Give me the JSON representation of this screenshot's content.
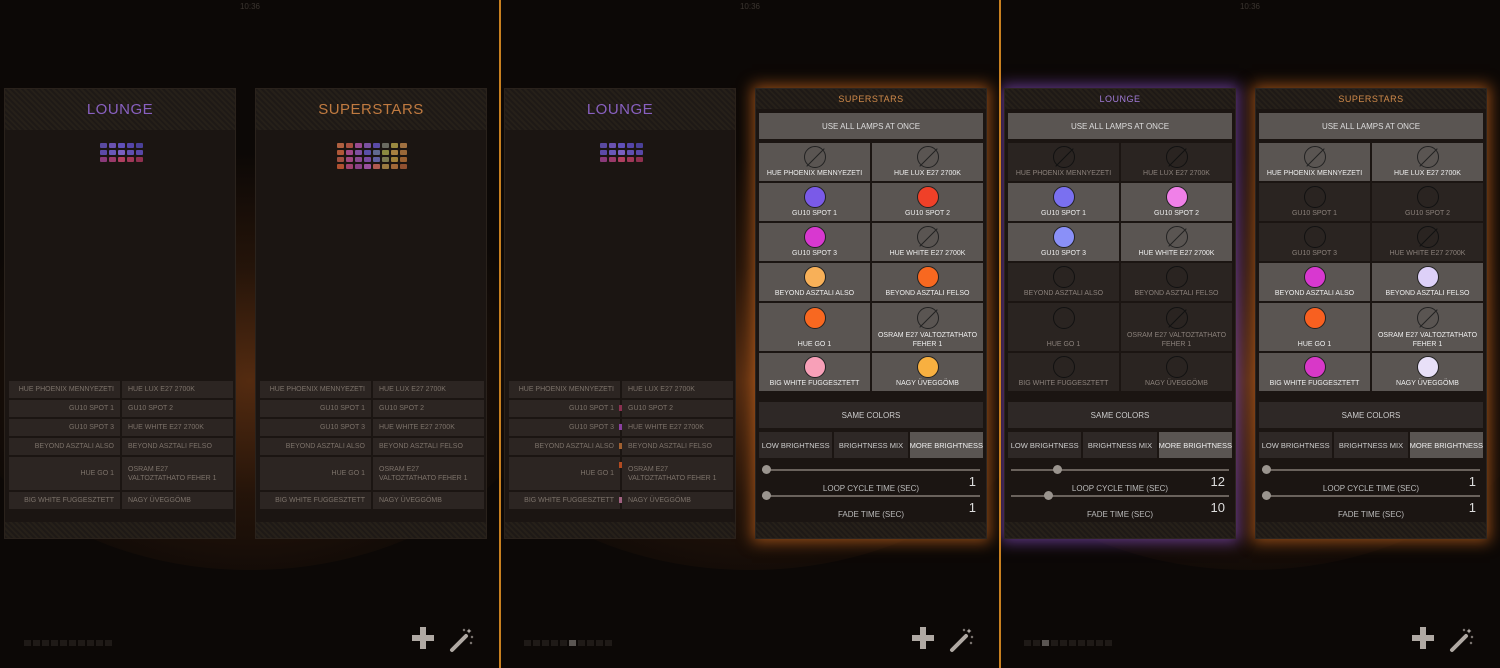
{
  "screens": [
    {
      "time": "10:36",
      "active_page": -1,
      "glow_color": "#c06020",
      "panels": [
        {
          "type": "collapsed",
          "title": "LOUNGE",
          "title_color": "#8860c0",
          "mini_grid": [
            "#5a4aa0",
            "#6a52b0",
            "#6050b8",
            "#5545a8",
            "#4a4098",
            "#5c4aa8",
            "#6a58b8",
            "#7a60c0",
            "#6050b0",
            "#5848a8",
            "#8a3a7a",
            "#9a3a6a",
            "#b04060",
            "#a03858",
            "#903050"
          ],
          "rows": [
            [
              {
                "label": "HUE PHOENIX MENNYEZETI"
              },
              {
                "label": "HUE LUX E27 2700K"
              }
            ],
            [
              {
                "label": "GU10 SPOT 1"
              },
              {
                "label": "GU10 SPOT 2"
              }
            ],
            [
              {
                "label": "GU10 SPOT 3"
              },
              {
                "label": "HUE WHITE E27 2700K"
              }
            ],
            [
              {
                "label": "BEYOND ASZTALI ALSO"
              },
              {
                "label": "BEYOND ASZTALI FELSO"
              }
            ],
            [
              {
                "label": "HUE GO 1",
                "tall": true
              },
              {
                "label": "OSRAM E27 VALTOZTATHATO FEHER 1",
                "tall": true
              }
            ],
            [
              {
                "label": "BIG WHITE FUGGESZTETT"
              },
              {
                "label": "NAGY ÜVEGGÖMB"
              }
            ]
          ]
        },
        {
          "type": "collapsed",
          "title": "SUPERSTARS",
          "title_color": "#c07a40",
          "mini_grid": [
            "#b06040",
            "#a85040",
            "#9a4a90",
            "#7a50a0",
            "#5a4aa8",
            "#6a6a60",
            "#9a8a40",
            "#a07040",
            "#b05838",
            "#a04888",
            "#8050a0",
            "#5a50a8",
            "#606a90",
            "#8a8a40",
            "#a88040",
            "#9a6838",
            "#a05040",
            "#a04880",
            "#8a4a90",
            "#7a4aa0",
            "#6060a0",
            "#7a7a50",
            "#a08038",
            "#9a6030",
            "#b05030",
            "#a04070",
            "#8a4088",
            "#9a50a0",
            "#b05a50",
            "#9a7a40",
            "#a06838",
            "#905030"
          ],
          "rows": [
            [
              {
                "label": "HUE PHOENIX MENNYEZETI"
              },
              {
                "label": "HUE LUX E27 2700K"
              }
            ],
            [
              {
                "label": "GU10 SPOT 1"
              },
              {
                "label": "GU10 SPOT 2"
              }
            ],
            [
              {
                "label": "GU10 SPOT 3"
              },
              {
                "label": "HUE WHITE E27 2700K"
              }
            ],
            [
              {
                "label": "BEYOND ASZTALI ALSO"
              },
              {
                "label": "BEYOND ASZTALI FELSO"
              }
            ],
            [
              {
                "label": "HUE GO 1",
                "tall": true
              },
              {
                "label": "OSRAM E27 VALTOZTATHATO FEHER 1",
                "tall": true
              }
            ],
            [
              {
                "label": "BIG WHITE FUGGESZTETT"
              },
              {
                "label": "NAGY ÜVEGGÖMB"
              }
            ]
          ]
        }
      ]
    },
    {
      "time": "10:36",
      "active_page": 5,
      "glow_color": "#c06020",
      "panels": [
        {
          "type": "collapsed",
          "title": "LOUNGE",
          "title_color": "#8860c0",
          "mini_grid": [
            "#5a4aa0",
            "#6a52b0",
            "#6050b8",
            "#5545a8",
            "#4a4098",
            "#5c4aa8",
            "#6a58b8",
            "#7a60c0",
            "#6050b0",
            "#5848a8",
            "#8a3a7a",
            "#9a3a6a",
            "#b04060",
            "#a03858",
            "#903050"
          ],
          "rows": [
            [
              {
                "label": "HUE PHOENIX MENNYEZETI"
              },
              {
                "label": "HUE LUX E27 2700K"
              }
            ],
            [
              {
                "label": "GU10 SPOT 1",
                "swatch": "#8a3050"
              },
              {
                "label": "GU10 SPOT 2"
              }
            ],
            [
              {
                "label": "GU10 SPOT 3",
                "swatch": "#8a40a0"
              },
              {
                "label": "HUE WHITE E27 2700K"
              }
            ],
            [
              {
                "label": "BEYOND ASZTALI ALSO",
                "swatch": "#a06030"
              },
              {
                "label": "BEYOND ASZTALI FELSO"
              }
            ],
            [
              {
                "label": "HUE GO 1",
                "tall": true,
                "swatch": "#b04a20"
              },
              {
                "label": "OSRAM E27 VALTOZTATHATO FEHER 1",
                "tall": true
              }
            ],
            [
              {
                "label": "BIG WHITE FUGGESZTETT",
                "swatch": "#a06080"
              },
              {
                "label": "NAGY ÜVEGGÖMB"
              }
            ]
          ]
        },
        {
          "type": "expanded",
          "title": "SUPERSTARS",
          "title_color": "#d08a4a",
          "border_glow": "#d06a20",
          "use_all_label": "USE ALL LAMPS AT ONCE",
          "lamps": [
            {
              "name": "HUE PHOENIX MENNYEZETI",
              "color": null,
              "dim": false
            },
            {
              "name": "HUE LUX E27 2700K",
              "color": null,
              "dim": false
            },
            {
              "name": "GU10 SPOT 1",
              "color": "#7a5ae8",
              "dim": false
            },
            {
              "name": "GU10 SPOT 2",
              "color": "#f04028",
              "dim": false
            },
            {
              "name": "GU10 SPOT 3",
              "color": "#d838d0",
              "dim": false
            },
            {
              "name": "HUE WHITE E27 2700K",
              "color": null,
              "dim": false
            },
            {
              "name": "BEYOND ASZTALI ALSO",
              "color": "#f8b058",
              "dim": false
            },
            {
              "name": "BEYOND ASZTALI FELSO",
              "color": "#f86820",
              "dim": false
            },
            {
              "name": "HUE GO 1",
              "color": "#f86820",
              "dim": false,
              "tall": true
            },
            {
              "name": "OSRAM E27 VALTOZTATHATO FEHER 1",
              "color": null,
              "dim": false,
              "tall": true
            },
            {
              "name": "BIG WHITE FUGGESZTETT",
              "color": "#f8a0b8",
              "dim": false
            },
            {
              "name": "NAGY ÜVEGGÖMB",
              "color": "#f8b040",
              "dim": false
            }
          ],
          "same_colors_label": "SAME COLORS",
          "brightness_options": [
            "LOW BRIGHTNESS",
            "BRIGHTNESS MIX",
            "MORE BRIGHTNESS"
          ],
          "brightness_active": 2,
          "loop_label": "LOOP CYCLE TIME (SEC)",
          "loop_value": "1",
          "loop_fraction": 0.0,
          "fade_label": "FADE TIME (SEC)",
          "fade_value": "1",
          "fade_fraction": 0.0
        }
      ]
    },
    {
      "time": "10:36",
      "active_page": 2,
      "glow_color": "#a05020",
      "panels": [
        {
          "type": "expanded",
          "title": "LOUNGE",
          "title_color": "#a07ad8",
          "border_glow": "#8a50c8",
          "use_all_label": "USE ALL LAMPS AT ONCE",
          "lamps": [
            {
              "name": "HUE PHOENIX MENNYEZETI",
              "color": null,
              "dim": true
            },
            {
              "name": "HUE LUX E27 2700K",
              "color": null,
              "dim": true
            },
            {
              "name": "GU10 SPOT 1",
              "color": "#7a70f0",
              "dim": false
            },
            {
              "name": "GU10 SPOT 2",
              "color": "#f080e8",
              "dim": false
            },
            {
              "name": "GU10 SPOT 3",
              "color": "#8a90f8",
              "dim": false
            },
            {
              "name": "HUE WHITE E27 2700K",
              "color": null,
              "dim": false
            },
            {
              "name": "BEYOND ASZTALI ALSO",
              "color": "off",
              "dim": true
            },
            {
              "name": "BEYOND ASZTALI FELSO",
              "color": "off",
              "dim": true
            },
            {
              "name": "HUE GO 1",
              "color": "off",
              "dim": true,
              "tall": true
            },
            {
              "name": "OSRAM E27 VALTOZTATHATO FEHER 1",
              "color": null,
              "dim": true,
              "tall": true
            },
            {
              "name": "BIG WHITE FUGGESZTETT",
              "color": "off",
              "dim": true
            },
            {
              "name": "NAGY ÜVEGGÖMB",
              "color": "off",
              "dim": true
            }
          ],
          "same_colors_label": "SAME COLORS",
          "brightness_options": [
            "LOW BRIGHTNESS",
            "BRIGHTNESS MIX",
            "MORE BRIGHTNESS"
          ],
          "brightness_active": 2,
          "loop_label": "LOOP CYCLE TIME (SEC)",
          "loop_value": "12",
          "loop_fraction": 0.2,
          "fade_label": "FADE TIME (SEC)",
          "fade_value": "10",
          "fade_fraction": 0.16
        },
        {
          "type": "expanded",
          "title": "SUPERSTARS",
          "title_color": "#d08a4a",
          "border_glow": "#d06a20",
          "use_all_label": "USE ALL LAMPS AT ONCE",
          "lamps": [
            {
              "name": "HUE PHOENIX MENNYEZETI",
              "color": null,
              "dim": false
            },
            {
              "name": "HUE LUX E27 2700K",
              "color": null,
              "dim": false
            },
            {
              "name": "GU10 SPOT 1",
              "color": "off",
              "dim": true
            },
            {
              "name": "GU10 SPOT 2",
              "color": "off",
              "dim": true
            },
            {
              "name": "GU10 SPOT 3",
              "color": "off",
              "dim": true
            },
            {
              "name": "HUE WHITE E27 2700K",
              "color": null,
              "dim": true
            },
            {
              "name": "BEYOND ASZTALI ALSO",
              "color": "#d838d0",
              "dim": false
            },
            {
              "name": "BEYOND ASZTALI FELSO",
              "color": "#ddd0f8",
              "dim": false
            },
            {
              "name": "HUE GO 1",
              "color": "#f86020",
              "dim": false,
              "tall": true
            },
            {
              "name": "OSRAM E27 VALTOZTATHATO FEHER 1",
              "color": null,
              "dim": false,
              "tall": true
            },
            {
              "name": "BIG WHITE FUGGESZTETT",
              "color": "#d838c8",
              "dim": false
            },
            {
              "name": "NAGY ÜVEGGÖMB",
              "color": "#e8e0f8",
              "dim": false
            }
          ],
          "same_colors_label": "SAME COLORS",
          "brightness_options": [
            "LOW BRIGHTNESS",
            "BRIGHTNESS MIX",
            "MORE BRIGHTNESS"
          ],
          "brightness_active": 2,
          "loop_label": "LOOP CYCLE TIME (SEC)",
          "loop_value": "1",
          "loop_fraction": 0.0,
          "fade_label": "FADE TIME (SEC)",
          "fade_value": "1",
          "fade_fraction": 0.0
        }
      ]
    }
  ],
  "page_count": 10,
  "icons": {
    "add": "plus-icon",
    "scenes": "magic-wand-icon"
  },
  "colors": {
    "divider": "#c88020",
    "panel_bg": "#1b1512",
    "tile_on": "#5a5552",
    "tile_dim": "#2a2421"
  }
}
